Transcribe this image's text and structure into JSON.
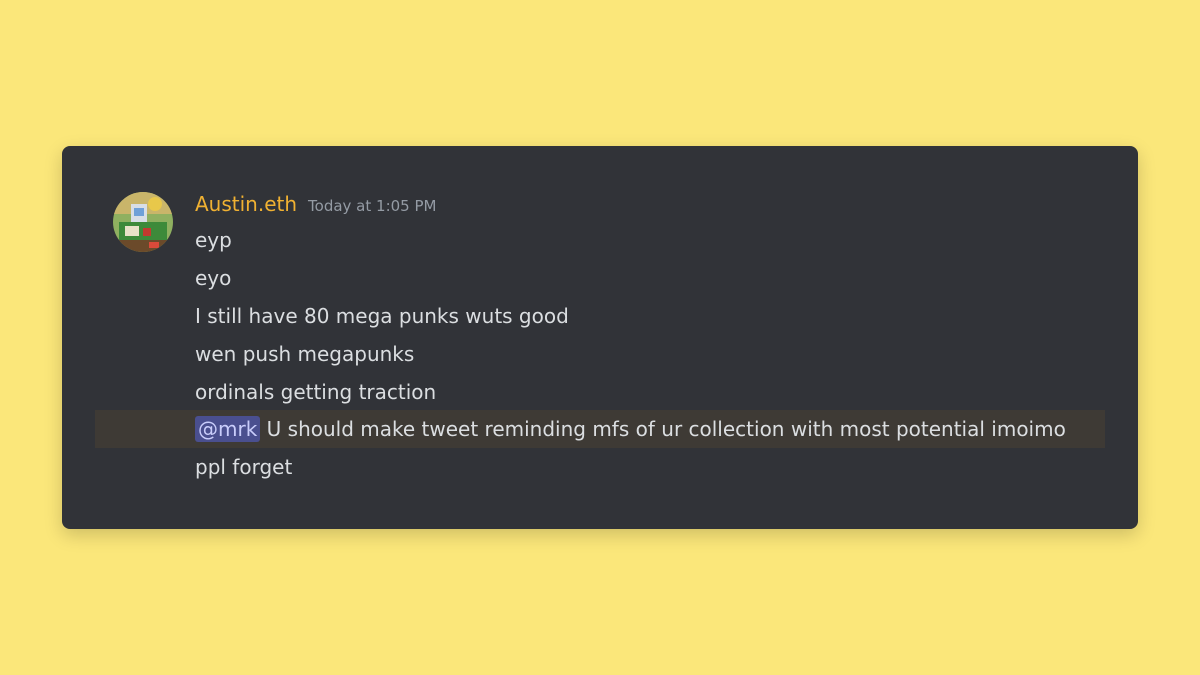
{
  "colors": {
    "background": "#fbe77a",
    "card": "#313338",
    "username": "#f0b132",
    "timestamp": "#949ba4",
    "message_text": "#dbdee1",
    "mention_bg": "#4a4f8f",
    "highlight_row": "#3e3a35"
  },
  "message_group": {
    "avatar_icon": "user-avatar-icon",
    "username": "Austin.eth",
    "timestamp": "Today at 1:05 PM",
    "messages": [
      {
        "text": "eyp"
      },
      {
        "text": "eyo"
      },
      {
        "text": "I still have 80 mega punks wuts good"
      },
      {
        "text": "wen push megapunks"
      },
      {
        "text": "ordinals getting traction"
      },
      {
        "mention": "@mrk",
        "text": " U should make tweet reminding mfs of ur collection with most potential imoimo"
      },
      {
        "text": "ppl forget"
      }
    ]
  }
}
